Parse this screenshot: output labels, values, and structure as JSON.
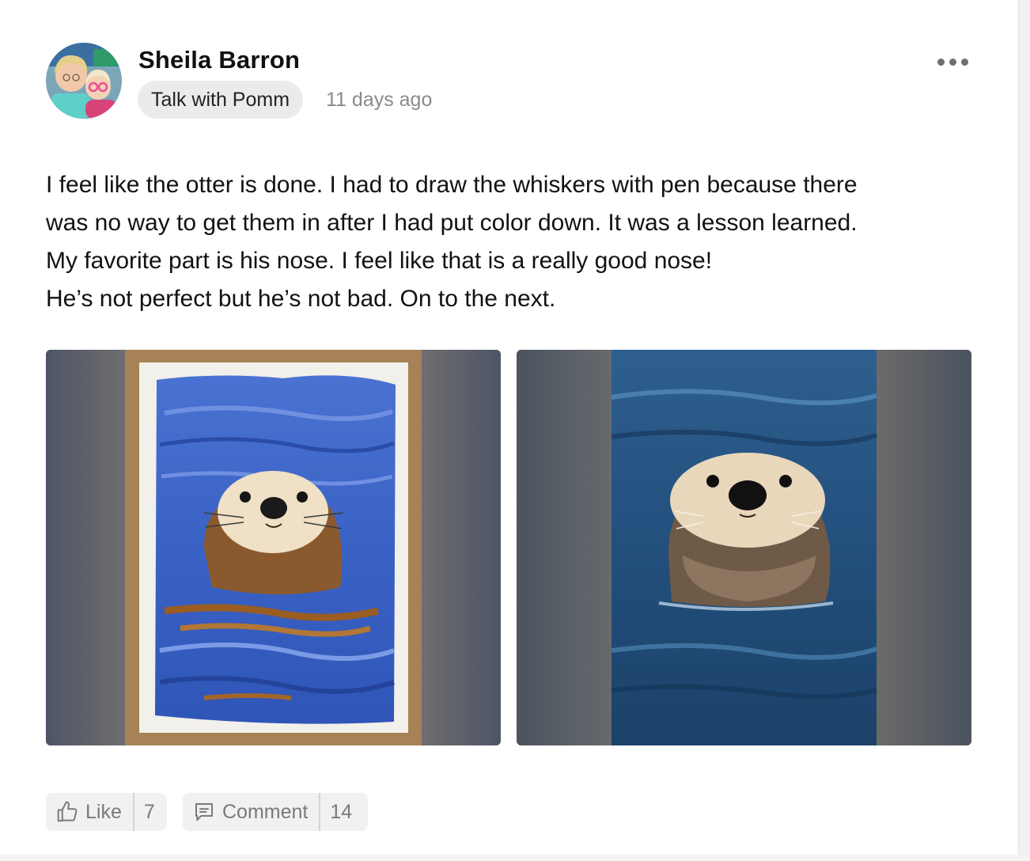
{
  "post": {
    "author": {
      "name": "Sheila Barron",
      "avatar": "avatar-photo"
    },
    "space_label": "Talk with Pomm",
    "time_ago": "11 days ago",
    "more_icon": "more-horizontal-icon",
    "body_lines": [
      "I feel like the otter is done. I had to draw the whiskers with pen because there",
      "was no way to get them in after I had put color down. It was a lesson learned.",
      "My favorite part is his nose. I feel like that is a really good nose!",
      "He’s not perfect but he’s not bad. On to the next."
    ],
    "images": [
      {
        "description_icon": "otter-painting-image"
      },
      {
        "description_icon": "otter-photo-image"
      }
    ]
  },
  "actions": {
    "like": {
      "label": "Like",
      "count": "7",
      "icon": "thumbs-up-icon"
    },
    "comment": {
      "label": "Comment",
      "count": "14",
      "icon": "comment-icon"
    }
  },
  "colors": {
    "chip_bg": "#ebebeb",
    "action_bg": "#f1f1f1",
    "muted_text": "#8a8a8a",
    "water_blue": "#3d63c9",
    "photo_water": "#1f4d7a"
  }
}
